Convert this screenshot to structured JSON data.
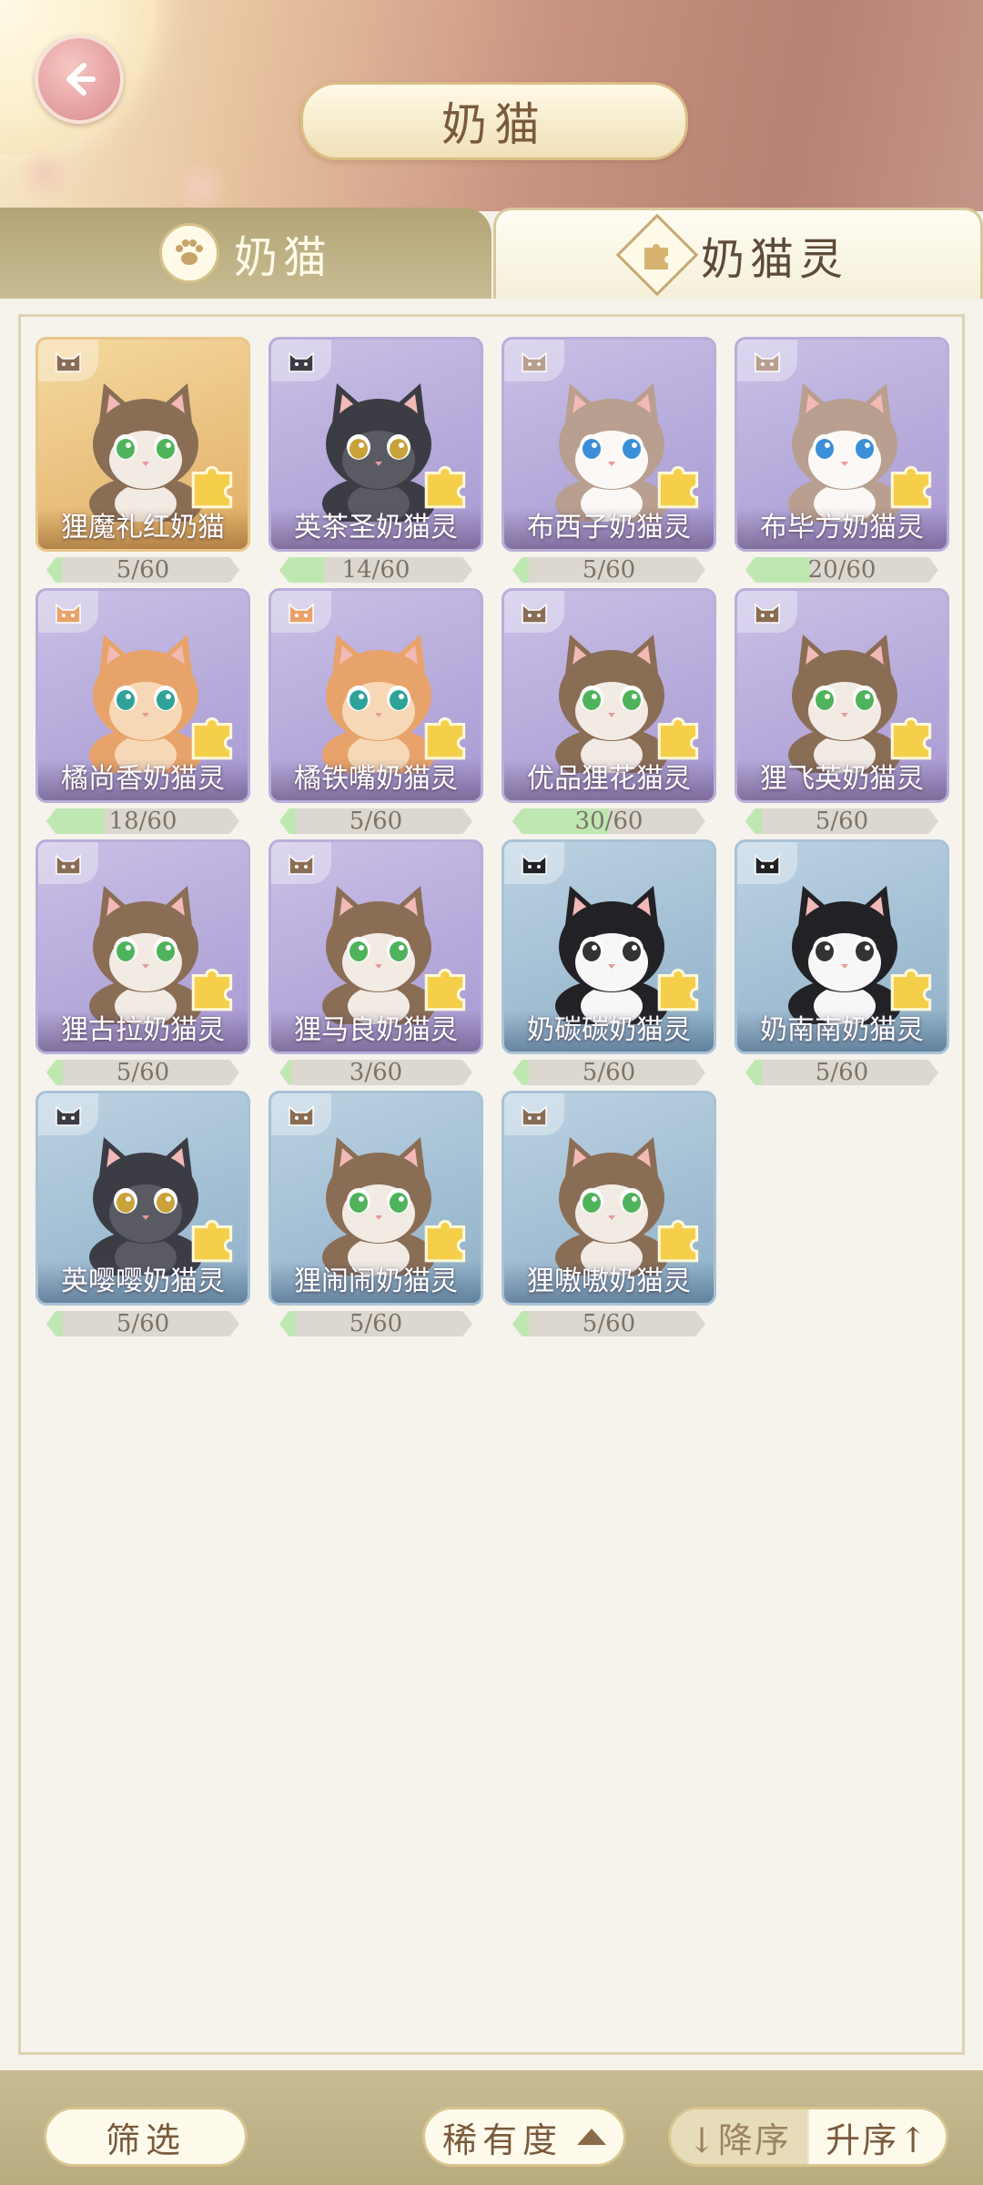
{
  "header": {
    "title": "奶猫"
  },
  "tabs": [
    {
      "label": "奶猫",
      "active": false
    },
    {
      "label": "奶猫灵",
      "active": true
    }
  ],
  "cards": [
    {
      "name": "狸魔礼红奶猫",
      "progress": "5/60",
      "fill": 0.08,
      "theme": "gold",
      "cat": "tabby"
    },
    {
      "name": "英茶圣奶猫灵",
      "progress": "14/60",
      "fill": 0.233,
      "theme": "purple",
      "cat": "black"
    },
    {
      "name": "布西子奶猫灵",
      "progress": "5/60",
      "fill": 0.083,
      "theme": "purple",
      "cat": "ragdoll"
    },
    {
      "name": "布毕方奶猫灵",
      "progress": "20/60",
      "fill": 0.333,
      "theme": "purple",
      "cat": "ragdoll"
    },
    {
      "name": "橘尚香奶猫灵",
      "progress": "18/60",
      "fill": 0.3,
      "theme": "purple",
      "cat": "orange"
    },
    {
      "name": "橘铁嘴奶猫灵",
      "progress": "5/60",
      "fill": 0.083,
      "theme": "purple",
      "cat": "orange"
    },
    {
      "name": "优品狸花猫灵",
      "progress": "30/60",
      "fill": 0.5,
      "theme": "purple",
      "cat": "tabby"
    },
    {
      "name": "狸飞英奶猫灵",
      "progress": "5/60",
      "fill": 0.083,
      "theme": "purple",
      "cat": "tabby"
    },
    {
      "name": "狸古拉奶猫灵",
      "progress": "5/60",
      "fill": 0.083,
      "theme": "purple",
      "cat": "tabby"
    },
    {
      "name": "狸马良奶猫灵",
      "progress": "3/60",
      "fill": 0.05,
      "theme": "purple",
      "cat": "tabby"
    },
    {
      "name": "奶碳碳奶猫灵",
      "progress": "5/60",
      "fill": 0.083,
      "theme": "blue",
      "cat": "tuxedo"
    },
    {
      "name": "奶南南奶猫灵",
      "progress": "5/60",
      "fill": 0.083,
      "theme": "blue",
      "cat": "tuxedo"
    },
    {
      "name": "英嘤嘤奶猫灵",
      "progress": "5/60",
      "fill": 0.083,
      "theme": "blue",
      "cat": "black"
    },
    {
      "name": "狸闹闹奶猫灵",
      "progress": "5/60",
      "fill": 0.083,
      "theme": "blue",
      "cat": "tabby"
    },
    {
      "name": "狸嗷嗷奶猫灵",
      "progress": "5/60",
      "fill": 0.083,
      "theme": "blue",
      "cat": "tabby"
    }
  ],
  "toolbar": {
    "filter_label": "筛选",
    "sort_field_label": "稀有度",
    "sort_desc_label": "↓降序",
    "sort_asc_label": "升序↑"
  },
  "icons": {
    "back": "back-arrow-icon",
    "paw": "paw-icon",
    "puzzle": "puzzle-icon",
    "caret": "caret-up-icon"
  },
  "colors": {
    "cat_coats": {
      "tabby": {
        "fur": "#8a6d55",
        "light": "#f2ebe4",
        "eye": "#4fb35c"
      },
      "black": {
        "fur": "#3c3c44",
        "light": "#5a5a62",
        "eye": "#c9a23a"
      },
      "ragdoll": {
        "fur": "#b89f8f",
        "light": "#fbf8f5",
        "eye": "#3a8fd8"
      },
      "orange": {
        "fur": "#e8a36a",
        "light": "#f7d8b6",
        "eye": "#2fa39a"
      },
      "tuxedo": {
        "fur": "#222226",
        "light": "#f7f7f7",
        "eye": "#333333"
      }
    }
  }
}
